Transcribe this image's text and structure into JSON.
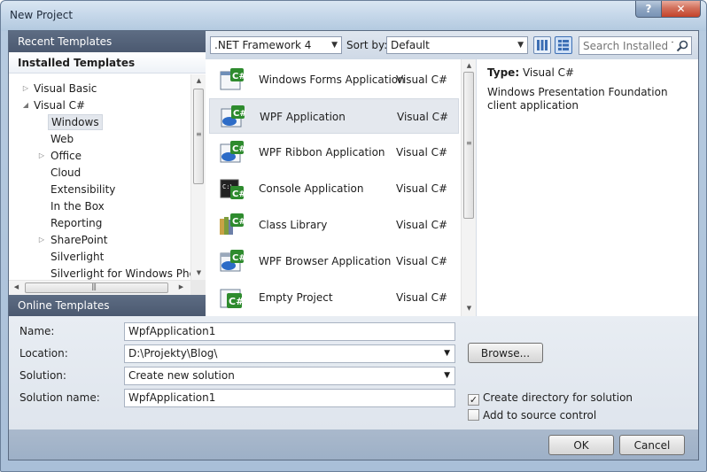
{
  "window": {
    "title": "New Project",
    "help_glyph": "?",
    "close_glyph": "✕"
  },
  "left": {
    "recent_header": "Recent Templates",
    "installed_header": "Installed Templates",
    "online_header": "Online Templates",
    "tree": [
      {
        "label": "Visual Basic",
        "expander": "▷"
      },
      {
        "label": "Visual C#",
        "expander": "◢"
      },
      {
        "label": "Windows",
        "expander": ""
      },
      {
        "label": "Web",
        "expander": ""
      },
      {
        "label": "Office",
        "expander": "▷"
      },
      {
        "label": "Cloud",
        "expander": ""
      },
      {
        "label": "Extensibility",
        "expander": ""
      },
      {
        "label": "In the Box",
        "expander": ""
      },
      {
        "label": "Reporting",
        "expander": ""
      },
      {
        "label": "SharePoint",
        "expander": "▷"
      },
      {
        "label": "Silverlight",
        "expander": ""
      },
      {
        "label": "Silverlight for Windows Phone",
        "expander": ""
      }
    ]
  },
  "toolbar": {
    "framework": ".NET Framework 4",
    "sort_label": "Sort by:",
    "sort_value": "Default",
    "search_placeholder": "Search Installed Ter"
  },
  "templates": [
    {
      "name": "Windows Forms Application",
      "lang": "Visual C#",
      "icon": "winforms-icon"
    },
    {
      "name": "WPF Application",
      "lang": "Visual C#",
      "icon": "wpf-icon"
    },
    {
      "name": "WPF Ribbon Application",
      "lang": "Visual C#",
      "icon": "wpf-ribbon-icon"
    },
    {
      "name": "Console Application",
      "lang": "Visual C#",
      "icon": "console-icon"
    },
    {
      "name": "Class Library",
      "lang": "Visual C#",
      "icon": "class-library-icon"
    },
    {
      "name": "WPF Browser Application",
      "lang": "Visual C#",
      "icon": "wpf-browser-icon"
    },
    {
      "name": "Empty Project",
      "lang": "Visual C#",
      "icon": "empty-project-icon"
    }
  ],
  "details": {
    "type_label": "Type:",
    "type_value": "Visual C#",
    "description": "Windows Presentation Foundation client application"
  },
  "form": {
    "name_label": "Name:",
    "name_value": "WpfApplication1",
    "location_label": "Location:",
    "location_value": "D:\\Projekty\\Blog\\",
    "solution_label": "Solution:",
    "solution_value": "Create new solution",
    "solution_name_label": "Solution name:",
    "solution_name_value": "WpfApplication1",
    "browse_label": "Browse...",
    "create_dir_label": "Create directory for solution",
    "create_dir_checked": true,
    "add_source_label": "Add to source control",
    "add_source_checked": false,
    "check_glyph": "✓"
  },
  "footer": {
    "ok_label": "OK",
    "cancel_label": "Cancel"
  }
}
